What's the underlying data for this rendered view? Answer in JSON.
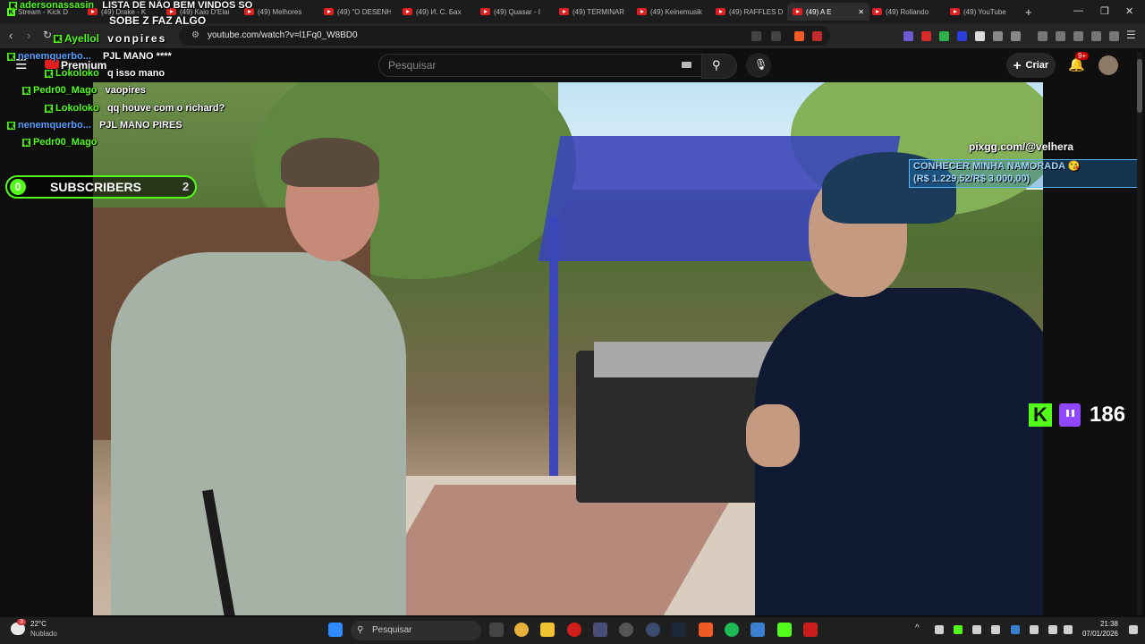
{
  "browser": {
    "tabs": [
      {
        "label": "Stream - Kick D",
        "icon": "kick-icon"
      },
      {
        "label": "(49) Drake - K",
        "icon": "youtube-icon"
      },
      {
        "label": "(49) Kaio D'Elai",
        "icon": "youtube-icon"
      },
      {
        "label": "(49) Melhores",
        "icon": "youtube-icon"
      },
      {
        "label": "(49) \"O DESENH",
        "icon": "youtube-icon"
      },
      {
        "label": "(49) И. С. Бах",
        "icon": "youtube-icon"
      },
      {
        "label": "(49) Quasar - I",
        "icon": "youtube-icon"
      },
      {
        "label": "(49) TERMINAR",
        "icon": "youtube-icon"
      },
      {
        "label": "(49) Keinemusik",
        "icon": "youtube-icon"
      },
      {
        "label": "(49) RAFFLES D",
        "icon": "youtube-icon"
      },
      {
        "label": "(49) A E",
        "icon": "youtube-icon",
        "active": true
      },
      {
        "label": "(49) Rollando",
        "icon": "youtube-icon"
      },
      {
        "label": "(49) YouTube",
        "icon": "youtube-icon"
      }
    ],
    "url": "youtube.com/watch?v=l1Fq0_W8BD0"
  },
  "youtube": {
    "logo_label": "Premium",
    "search_placeholder": "Pesquisar",
    "create_label": "Criar",
    "notifications_badge": "9+"
  },
  "overlays": {
    "top_alert_user": "adersonassasin",
    "top_alert_line1": "LISTA DE NÃO BEM VINDOS SO",
    "top_alert_line2": "SOBE Z FAZ ALGO",
    "streamer_name": "Ayellol",
    "streamer_tag": "vonpires",
    "chat": [
      {
        "user": "nenemquerbo...",
        "message": "PJL MANO ****",
        "user_color": "#5aa0ff"
      },
      {
        "user": "Lokoloko",
        "message": "q isso mano",
        "user_color": "#53fc18"
      },
      {
        "user": "Pedr00_Mago",
        "message": "vaopires",
        "user_color": "#53fc18"
      },
      {
        "user": "Lokoloko",
        "message": "qq houve com o richard?",
        "user_color": "#53fc18"
      },
      {
        "user": "nenemquerbo...",
        "message": "PJL MANO PIRES",
        "user_color": "#5aa0ff"
      },
      {
        "user": "Pedr00_Mago",
        "message": "",
        "user_color": "#53fc18"
      }
    ],
    "subscribers_label": "SUBSCRIBERS",
    "subscribers_current": "0",
    "subscribers_goal": "2",
    "pix_handle": "pixgg.com/@velhera",
    "goal_title": "CONHECER MINHA NAMORADA 😘",
    "goal_progress": "(R$ 1.229,52/R$ 3.000,00)",
    "viewer_count": "186"
  },
  "taskbar": {
    "weather_temp": "22°C",
    "weather_desc": "Nublado",
    "weather_badge": "3",
    "search_label": "Pesquisar",
    "time": "21:38",
    "date": "07/01/2026"
  },
  "colors": {
    "kick_green": "#53fc18",
    "youtube_red": "#e02020",
    "twitch_purple": "#9146ff"
  }
}
